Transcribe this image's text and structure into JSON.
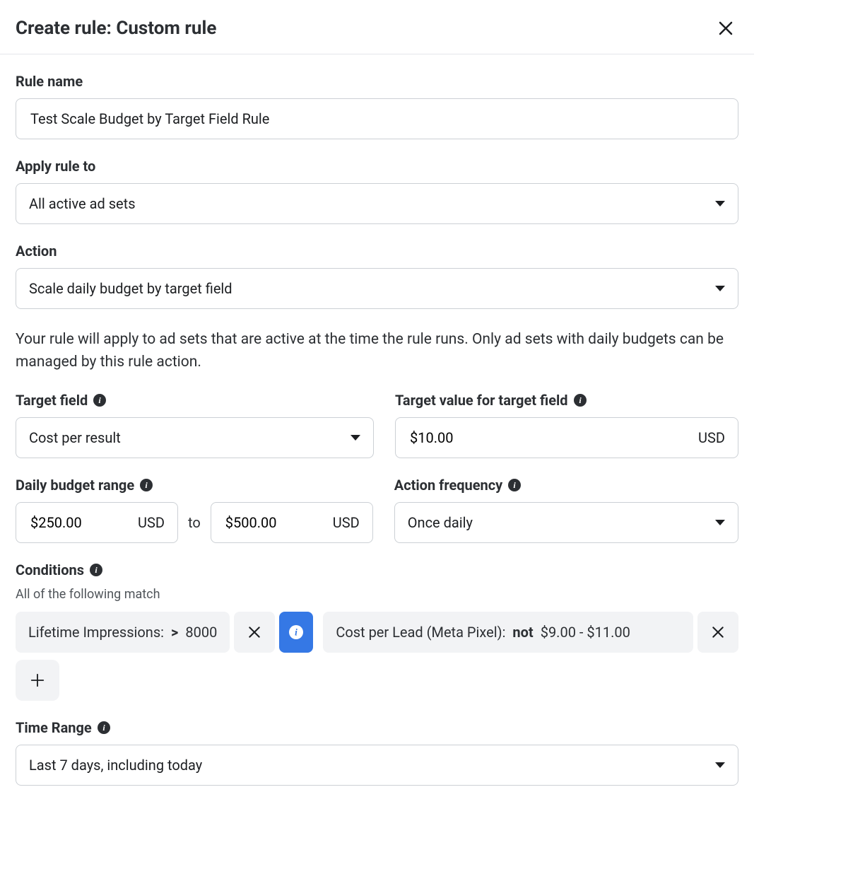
{
  "header": {
    "title": "Create rule: Custom rule"
  },
  "rule_name": {
    "label": "Rule name",
    "value": "Test Scale Budget by Target Field Rule"
  },
  "apply_rule_to": {
    "label": "Apply rule to",
    "value": "All active ad sets"
  },
  "action": {
    "label": "Action",
    "value": "Scale daily budget by target field"
  },
  "helper_text": "Your rule will apply to ad sets that are active at the time the rule runs. Only ad sets with daily budgets can be managed by this rule action.",
  "target_field": {
    "label": "Target field",
    "value": "Cost per result"
  },
  "target_value": {
    "label": "Target value for target field",
    "value": "$10.00",
    "currency": "USD"
  },
  "daily_budget_range": {
    "label": "Daily budget range",
    "min": "$250.00",
    "max": "$500.00",
    "currency": "USD",
    "connector": "to"
  },
  "action_frequency": {
    "label": "Action frequency",
    "value": "Once daily"
  },
  "conditions": {
    "label": "Conditions",
    "subtext": "All of the following match",
    "items": [
      {
        "field": "Lifetime Impressions:",
        "operator": ">",
        "value": "8000"
      },
      {
        "field": "Cost per Lead (Meta Pixel):",
        "operator": "not",
        "value": "$9.00 - $11.00"
      }
    ]
  },
  "time_range": {
    "label": "Time Range",
    "value": "Last 7 days, including today"
  }
}
